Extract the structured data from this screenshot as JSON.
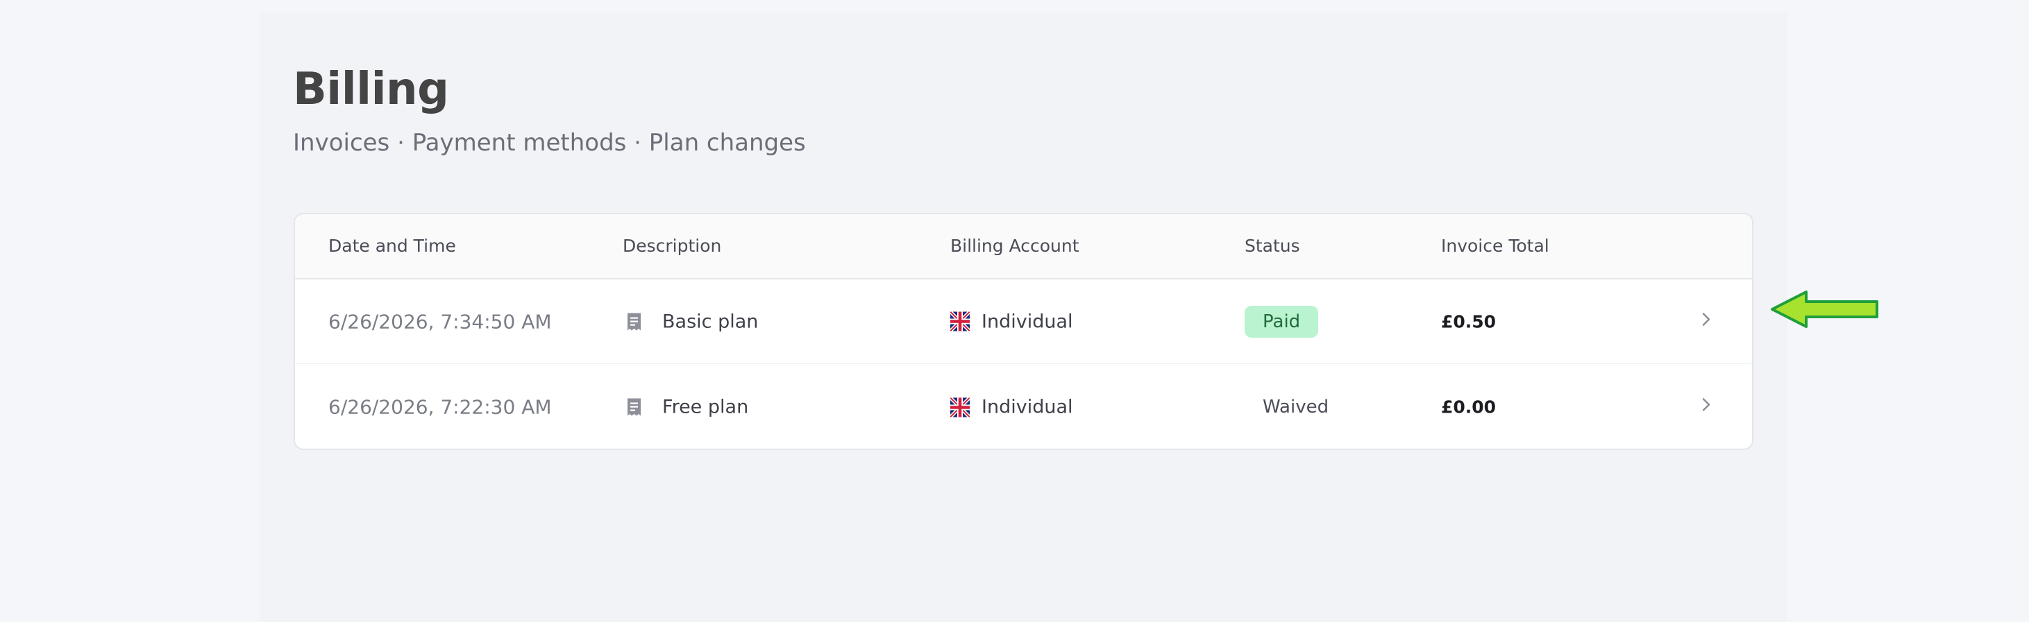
{
  "page": {
    "title": "Billing",
    "subtitle": "Invoices · Payment methods · Plan changes"
  },
  "table": {
    "headers": [
      "Date and Time",
      "Description",
      "Billing Account",
      "Status",
      "Invoice Total"
    ],
    "rows": [
      {
        "datetime": "6/26/2026, 7:34:50 AM",
        "description": "Basic plan",
        "description_icon": "receipt-icon",
        "account": "Individual",
        "account_icon": "uk-flag-icon",
        "status": "Paid",
        "total": "£0.50"
      },
      {
        "datetime": "6/26/2026, 7:22:30 AM",
        "description": "Free plan",
        "description_icon": "receipt-icon",
        "account": "Individual",
        "account_icon": "uk-flag-icon",
        "status": "Waived",
        "total": "£0.00"
      }
    ]
  },
  "colors": {
    "paid_badge_bg": "#b9f3cf",
    "paid_badge_text": "#256b3d",
    "arrow_fill": "#a6e22e",
    "arrow_stroke": "#1f9e3a"
  },
  "annotations": {
    "pointer_arrow_icon": "left-arrow-icon"
  }
}
